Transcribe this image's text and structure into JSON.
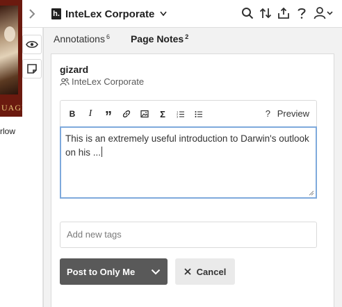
{
  "book": {
    "band_text": "UAGE",
    "page_text": "rlow"
  },
  "sidebar": {
    "toggle_icon": "chevron-right-icon",
    "group_name": "InteLex Corporate",
    "logo_glyph": "h.",
    "toolbar_icons": [
      "search-icon",
      "sort-icon",
      "share-icon",
      "help-icon",
      "user-icon"
    ],
    "rail_buttons": [
      "eye-icon",
      "note-icon"
    ]
  },
  "tabs": [
    {
      "label": "Annotations",
      "count": "6",
      "active": false
    },
    {
      "label": "Page Notes",
      "count": "2",
      "active": true
    }
  ],
  "annotation": {
    "user": "gizard",
    "group": "InteLex Corporate",
    "toolbar": {
      "buttons": [
        "B",
        "I",
        "”",
        "link",
        "image",
        "Σ",
        "ordered-list",
        "bullet-list"
      ],
      "help": "?",
      "preview": "Preview"
    },
    "text": "This is an extremely useful introduction to Darwin's outlook on his ...",
    "tags_placeholder": "Add new tags",
    "post_label": "Post to Only Me",
    "cancel_label": "Cancel"
  },
  "colors": {
    "accent_focus": "#7ea9dc",
    "post_button": "#595959",
    "panel_bg": "#f2f2f2"
  }
}
